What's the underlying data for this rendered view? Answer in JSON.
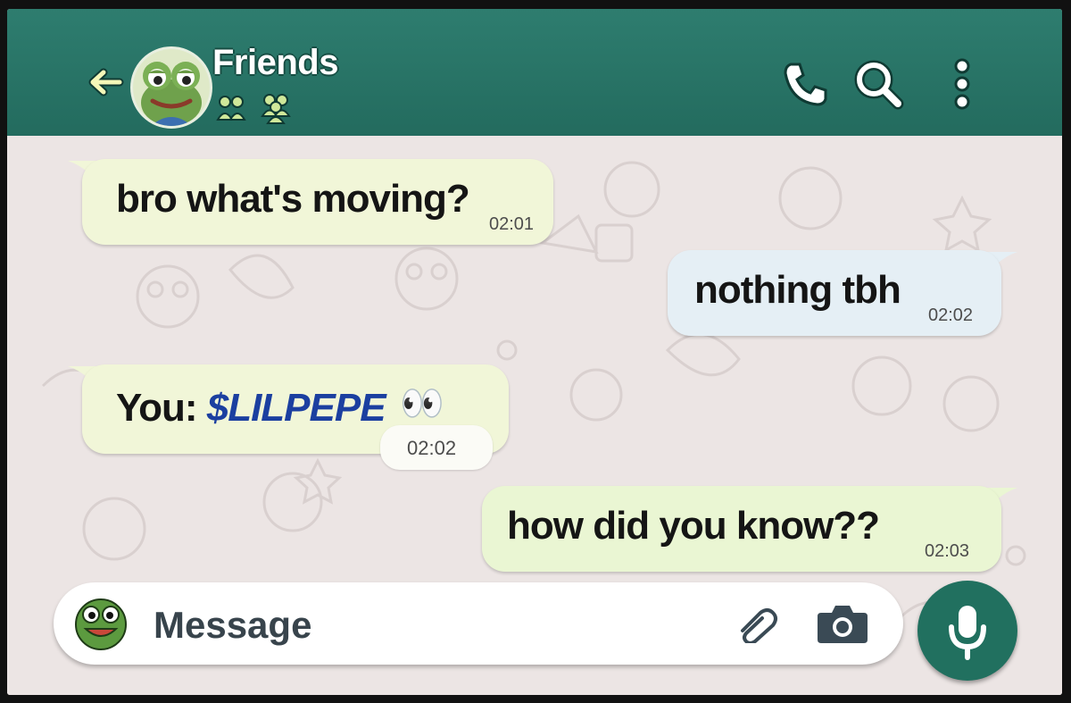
{
  "header": {
    "title": "Friends",
    "colors": {
      "bar": "#2e7d6f",
      "accent": "#21705f"
    },
    "icons": [
      "back-arrow-icon",
      "group-members-icon",
      "phone-icon",
      "search-icon",
      "more-vertical-icon"
    ]
  },
  "messages": [
    {
      "direction": "incoming",
      "text": "bro what's moving?",
      "time": "02:01"
    },
    {
      "direction": "outgoing",
      "text": "nothing tbh",
      "time": "02:02"
    },
    {
      "direction": "incoming",
      "prefix": "You: ",
      "ticker": "$LILPEPE",
      "emoji": "👀",
      "time": "02:02"
    },
    {
      "direction": "outgoing",
      "text": "how did you know??",
      "time": "02:03"
    }
  ],
  "composer": {
    "placeholder": "Message",
    "icons": [
      "attach-icon",
      "camera-icon",
      "mic-icon"
    ]
  }
}
